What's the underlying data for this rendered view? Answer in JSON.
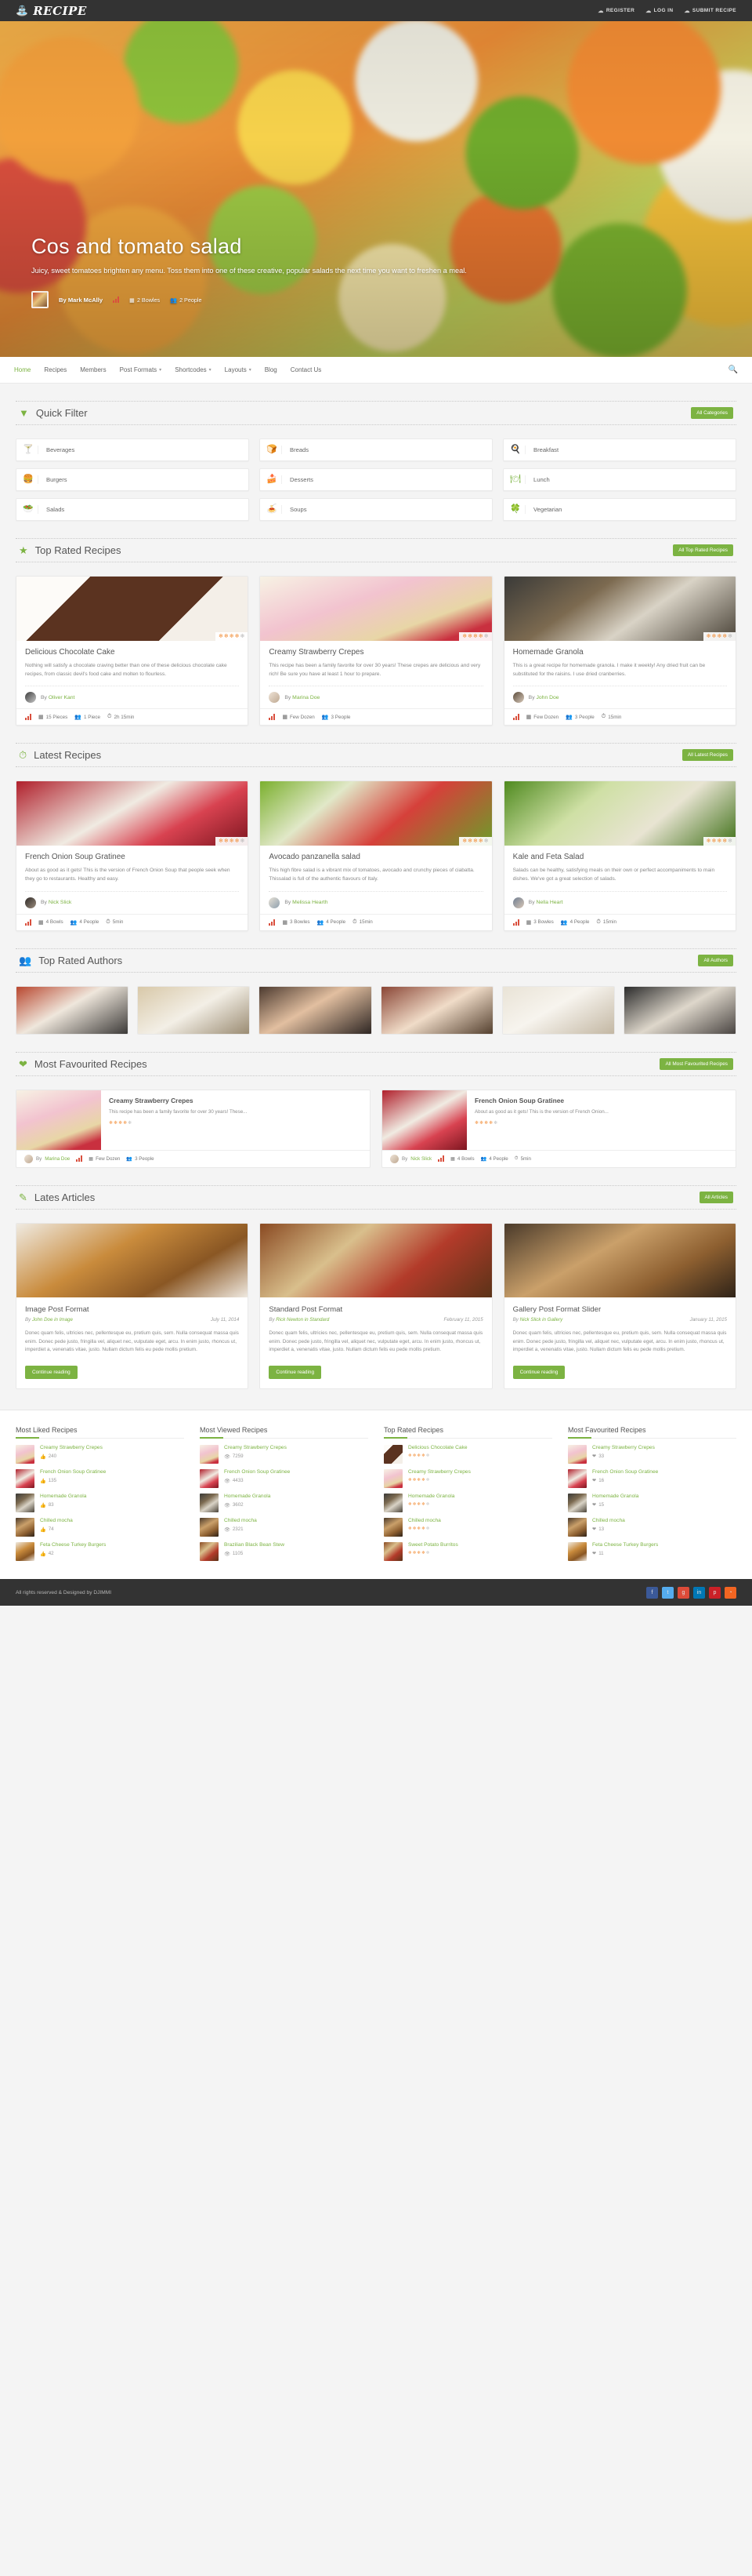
{
  "site": {
    "brand": "RECIPE",
    "brand_icon": "chef-hat-icon",
    "copyright": "All rights reserved & Designed by DJIMMI"
  },
  "topnav": [
    {
      "label": "REGISTER",
      "icon": "user-add-icon"
    },
    {
      "label": "LOG IN",
      "icon": "login-icon"
    },
    {
      "label": "SUBMIT RECIPE",
      "icon": "upload-icon"
    }
  ],
  "hero": {
    "title": "Cos and tomato salad",
    "description": "Juicy, sweet tomatoes brighten any menu. Toss them into one of these creative, popular salads the next time you want to freshen a meal.",
    "author": "By Mark McAlly",
    "servings": "2 Bowles",
    "people": "2 People"
  },
  "mainnav": [
    {
      "label": "Home",
      "active": true,
      "dropdown": false
    },
    {
      "label": "Recipes",
      "active": false,
      "dropdown": false
    },
    {
      "label": "Members",
      "active": false,
      "dropdown": false
    },
    {
      "label": "Post Formats",
      "active": false,
      "dropdown": true
    },
    {
      "label": "Shortcodes",
      "active": false,
      "dropdown": true
    },
    {
      "label": "Layouts",
      "active": false,
      "dropdown": true
    },
    {
      "label": "Blog",
      "active": false,
      "dropdown": false
    },
    {
      "label": "Contact Us",
      "active": false,
      "dropdown": false
    }
  ],
  "search": {
    "icon": "search-icon"
  },
  "quick_filter": {
    "title": "Quick Filter",
    "icon": "filter-icon",
    "button": "All Categories",
    "categories": [
      {
        "label": "Beverages",
        "icon": "cocktail-glass-icon"
      },
      {
        "label": "Breads",
        "icon": "bread-icon"
      },
      {
        "label": "Breakfast",
        "icon": "egg-icon"
      },
      {
        "label": "Burgers",
        "icon": "burger-icon"
      },
      {
        "label": "Desserts",
        "icon": "cake-slice-icon"
      },
      {
        "label": "Lunch",
        "icon": "hot-dish-icon"
      },
      {
        "label": "Salads",
        "icon": "salad-icon"
      },
      {
        "label": "Soups",
        "icon": "soup-icon"
      },
      {
        "label": "Vegetarian",
        "icon": "leaf-icon"
      }
    ]
  },
  "top_rated": {
    "title": "Top Rated Recipes",
    "icon": "star-icon",
    "button": "All Top Rated Recipes",
    "cards": [
      {
        "title": "Delicious Chocolate Cake",
        "desc": "Nothing will satisfy a chocolate craving better than one of these delicious chocolate cake recipes, from classic devil's food cake and molten to flourless.",
        "author": "By Oliver Kant",
        "rating": 4.5,
        "meta": [
          {
            "icon": "grid-icon",
            "text": "15 Pieces"
          },
          {
            "icon": "people-icon",
            "text": "1 Piece"
          },
          {
            "icon": "clock-icon",
            "text": "2h 15min"
          }
        ],
        "thumb_class": "th-cake"
      },
      {
        "title": "Creamy Strawberry Crepes",
        "desc": "This recipe has been a family favorite for over 30 years! These crepes are delicious and very rich! Be sure you have at least 1 hour to prepare.",
        "author": "By Marina Doe",
        "rating": 4.5,
        "meta": [
          {
            "icon": "grid-icon",
            "text": "Few Dozen"
          },
          {
            "icon": "people-icon",
            "text": "3 People"
          }
        ],
        "thumb_class": "th-crepe"
      },
      {
        "title": "Homemade Granola",
        "desc": "This is a great recipe for homemade granola. I make it weekly! Any dried fruit can be substituted for the raisins. I use dried cranberries.",
        "author": "By John Doe",
        "rating": 4.5,
        "meta": [
          {
            "icon": "grid-icon",
            "text": "Few Dozen"
          },
          {
            "icon": "people-icon",
            "text": "3 People"
          },
          {
            "icon": "clock-icon",
            "text": "15min"
          }
        ],
        "thumb_class": "th-granola"
      }
    ]
  },
  "latest": {
    "title": "Latest Recipes",
    "icon": "clock-icon",
    "button": "All Latest Recipes",
    "cards": [
      {
        "title": "French Onion Soup Gratinee",
        "desc": "About as good as it gets! This is the version of French Onion Soup that people seek when they go to restaurants. Healthy and easy.",
        "author": "By Nick Slick",
        "rating": 4.5,
        "meta": [
          {
            "icon": "grid-icon",
            "text": "4 Bowls"
          },
          {
            "icon": "people-icon",
            "text": "4 People"
          },
          {
            "icon": "clock-icon",
            "text": "5min"
          }
        ],
        "thumb_class": "th-soup"
      },
      {
        "title": "Avocado panzanella salad",
        "desc": "This high fibre salad is a vibrant mix of tomatoes, avocado and crunchy pieces of ciabatta. Thissalad is full of the authentic flavours of Italy.",
        "author": "By Melissa Hearth",
        "rating": 4.5,
        "meta": [
          {
            "icon": "grid-icon",
            "text": "3 Bowles"
          },
          {
            "icon": "people-icon",
            "text": "4 People"
          },
          {
            "icon": "clock-icon",
            "text": "15min"
          }
        ],
        "thumb_class": "th-avocado"
      },
      {
        "title": "Kale and Feta Salad",
        "desc": "Salads can be healthy, satisfying meals on their own or perfect accompaniments to main dishes. We've got a great selection of salads.",
        "author": "By Nella Heart",
        "rating": 4.5,
        "meta": [
          {
            "icon": "grid-icon",
            "text": "3 Bowles"
          },
          {
            "icon": "people-icon",
            "text": "4 People"
          },
          {
            "icon": "clock-icon",
            "text": "15min"
          }
        ],
        "thumb_class": "th-kale"
      }
    ]
  },
  "authors": {
    "title": "Top Rated Authors",
    "icon": "users-icon",
    "button": "All Authors",
    "items": [
      {
        "name": "author-1",
        "class": "au1"
      },
      {
        "name": "author-2",
        "class": "au2"
      },
      {
        "name": "author-3",
        "class": "au3"
      },
      {
        "name": "author-4",
        "class": "au4"
      },
      {
        "name": "author-5",
        "class": "au5"
      },
      {
        "name": "author-6",
        "class": "au6"
      }
    ]
  },
  "favourited": {
    "title": "Most Favourited Recipes",
    "icon": "heart-icon",
    "button": "All Most Favourited Recipes",
    "cards": [
      {
        "title": "Creamy Strawberry Crepes",
        "desc": "This recipe has been a family favorite for over 30 years! These...",
        "author": "By Marina Doe",
        "rating": 4.5,
        "meta": [
          {
            "icon": "grid-icon",
            "text": "Few Dozen"
          },
          {
            "icon": "people-icon",
            "text": "3 People"
          }
        ],
        "thumb_class": "th-crepe"
      },
      {
        "title": "French Onion Soup Gratinee",
        "desc": "About as good as it gets! This is the version of French Onion...",
        "author": "By Nick Slick",
        "rating": 4.5,
        "meta": [
          {
            "icon": "grid-icon",
            "text": "4 Bowls"
          },
          {
            "icon": "people-icon",
            "text": "4 People"
          },
          {
            "icon": "clock-icon",
            "text": "5min"
          }
        ],
        "thumb_class": "th-soup"
      }
    ]
  },
  "articles": {
    "title": "Lates Articles",
    "icon": "pencil-icon",
    "button": "All Articles",
    "cards": [
      {
        "title": "Image Post Format",
        "author": "By John Doe in Image",
        "date": "July 11, 2014",
        "text": "Donec quam felis, ultricies nec, pellentesque eu, pretium quis, sem. Nulla consequat massa quis enim. Donec pede justo, fringilla vel, aliquet nec, vulputate eget, arcu. In enim justo, rhoncus ut, imperdiet a, venenatis vitae, justo. Nullam dictum felis eu pede mollis pretium.",
        "button": "Continue reading",
        "thumb_class": "th-burger"
      },
      {
        "title": "Standard Post Format",
        "author": "By Rick Newton in Standard",
        "date": "February 11, 2015",
        "text": "Donec quam felis, ultricies nec, pellentesque eu, pretium quis, sem. Nulla consequat massa quis enim. Donec pede justo, fringilla vel, aliquet nec, vulputate eget, arcu. In enim justo, rhoncus ut, imperdiet a, venenatis vitae, justo. Nullam dictum felis eu pede mollis pretium.",
        "button": "Continue reading",
        "thumb_class": "th-spice"
      },
      {
        "title": "Gallery Post Format Slider",
        "author": "By Nick Slick in Gallery",
        "date": "January 11, 2015",
        "text": "Donec quam felis, ultricies nec, pellentesque eu, pretium quis, sem. Nulla consequat massa quis enim. Donec pede justo, fringilla vel, aliquet nec, vulputate eget, arcu. In enim justo, rhoncus ut, imperdiet a, venenatis vitae, justo. Nullam dictum felis eu pede mollis pretium.",
        "button": "Continue reading",
        "thumb_class": "th-bowls"
      }
    ]
  },
  "widgets": [
    {
      "title": "Most Liked Recipes",
      "metric": "likes",
      "metric_icon": "thumbs-up-icon",
      "items": [
        {
          "name": "Creamy Strawberry Crepes",
          "value": "240",
          "thumb_class": "th-crepe"
        },
        {
          "name": "French Onion Soup Gratinee",
          "value": "135",
          "thumb_class": "th-soup"
        },
        {
          "name": "Homemade Granola",
          "value": "83",
          "thumb_class": "th-granola"
        },
        {
          "name": "Chilled mocha",
          "value": "74",
          "thumb_class": "th-bowls"
        },
        {
          "name": "Feta Cheese Turkey Burgers",
          "value": "42",
          "thumb_class": "th-burger"
        }
      ]
    },
    {
      "title": "Most Viewed Recipes",
      "metric": "views",
      "metric_icon": "eye-icon",
      "items": [
        {
          "name": "Creamy Strawberry Crepes",
          "value": "7259",
          "thumb_class": "th-crepe"
        },
        {
          "name": "French Onion Soup Gratinee",
          "value": "4433",
          "thumb_class": "th-soup"
        },
        {
          "name": "Homemade Granola",
          "value": "3602",
          "thumb_class": "th-granola"
        },
        {
          "name": "Chilled mocha",
          "value": "2321",
          "thumb_class": "th-bowls"
        },
        {
          "name": "Brazilian Black Bean Stew",
          "value": "1105",
          "thumb_class": "th-spice"
        }
      ]
    },
    {
      "title": "Top Rated Recipes",
      "metric": "rating",
      "metric_icon": "star-icon",
      "items": [
        {
          "name": "Delicious Chocolate Cake",
          "rating": 4.5,
          "thumb_class": "th-cake"
        },
        {
          "name": "Creamy Strawberry Crepes",
          "rating": 4.5,
          "thumb_class": "th-crepe"
        },
        {
          "name": "Homemade Granola",
          "rating": 4.5,
          "thumb_class": "th-granola"
        },
        {
          "name": "Chilled mocha",
          "rating": 4,
          "thumb_class": "th-bowls"
        },
        {
          "name": "Sweet Potato Burritos",
          "rating": 4,
          "thumb_class": "th-spice"
        }
      ]
    },
    {
      "title": "Most Favourited Recipes",
      "metric": "favourites",
      "metric_icon": "heart-icon",
      "items": [
        {
          "name": "Creamy Strawberry Crepes",
          "value": "33",
          "thumb_class": "th-crepe"
        },
        {
          "name": "French Onion Soup Gratinee",
          "value": "16",
          "thumb_class": "th-soup"
        },
        {
          "name": "Homemade Granola",
          "value": "15",
          "thumb_class": "th-granola"
        },
        {
          "name": "Chilled mocha",
          "value": "13",
          "thumb_class": "th-bowls"
        },
        {
          "name": "Feta Cheese Turkey Burgers",
          "value": "11",
          "thumb_class": "th-burger"
        }
      ]
    }
  ],
  "socials": [
    {
      "name": "facebook-icon",
      "glyph": "f",
      "class": "fb"
    },
    {
      "name": "twitter-icon",
      "glyph": "t",
      "class": "tw"
    },
    {
      "name": "google-plus-icon",
      "glyph": "g",
      "class": "gp"
    },
    {
      "name": "linkedin-icon",
      "glyph": "in",
      "class": "in"
    },
    {
      "name": "pinterest-icon",
      "glyph": "p",
      "class": "pi"
    },
    {
      "name": "rss-icon",
      "glyph": "◔",
      "class": "rs"
    }
  ],
  "colors": {
    "accent_green": "#7cb342",
    "dark_bar": "#333333",
    "star_orange": "#f2903c"
  }
}
